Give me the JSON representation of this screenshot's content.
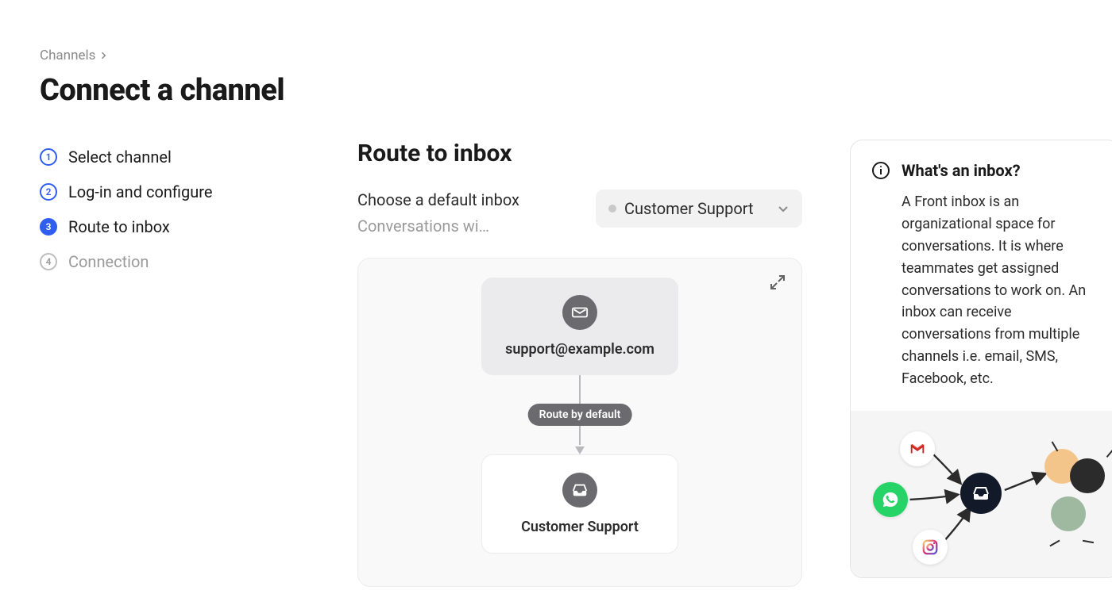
{
  "breadcrumb": {
    "parent": "Channels"
  },
  "page_title": "Connect a channel",
  "steps": [
    {
      "num": "1",
      "label": "Select channel",
      "state": "done"
    },
    {
      "num": "2",
      "label": "Log-in and configure",
      "state": "done"
    },
    {
      "num": "3",
      "label": "Route to inbox",
      "state": "active"
    },
    {
      "num": "4",
      "label": "Connection",
      "state": "future"
    }
  ],
  "main": {
    "heading": "Route to inbox",
    "field_label": "Choose a default inbox",
    "field_help": "Conversations wi…",
    "select_value": "Customer Support"
  },
  "diagram": {
    "source_label": "support@example.com",
    "edge_label": "Route by default",
    "target_label": "Customer Support"
  },
  "info": {
    "title": "What's an inbox?",
    "body": "A Front inbox is an organizational space for conversations. It is where teammates get assigned conversations to work on. An inbox can receive conversations from multiple channels i.e. email, SMS, Facebook, etc."
  }
}
